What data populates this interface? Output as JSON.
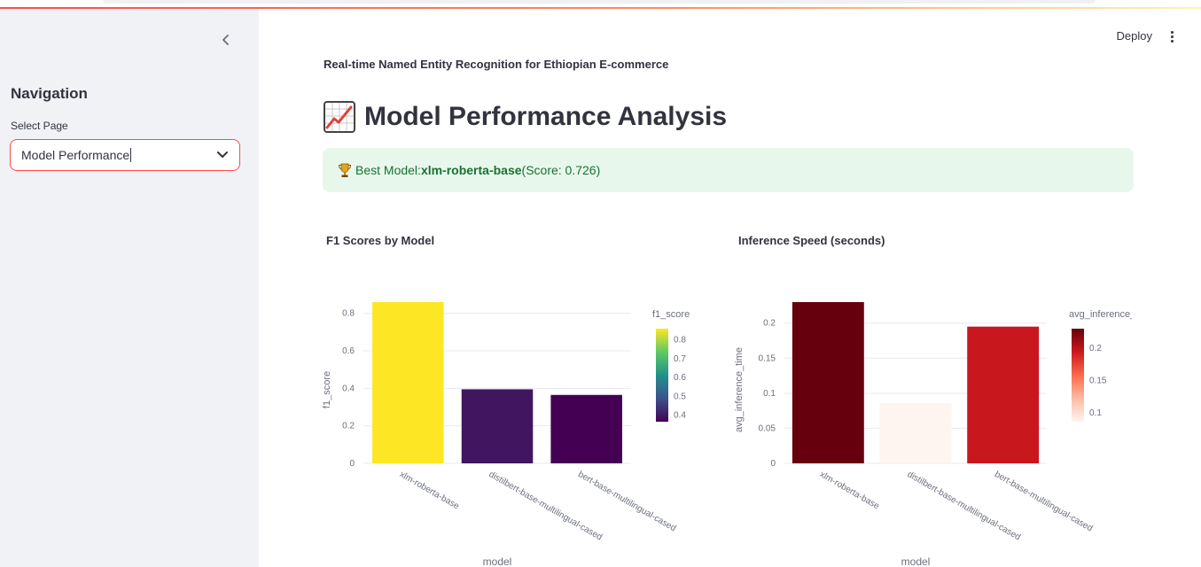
{
  "app": {
    "deploy_label": "Deploy"
  },
  "sidebar": {
    "heading": "Navigation",
    "select_label": "Select Page",
    "select_value": "Model Performance"
  },
  "main": {
    "subtitle": "Real-time Named Entity Recognition for Ethiopian E-commerce",
    "title": "Model Performance Analysis",
    "alert": {
      "prefix": "Best Model: ",
      "model": "xlm-roberta-base",
      "suffix": " (Score: 0.726)"
    }
  },
  "colors": {
    "accent": "#ff4b4b",
    "alert_bg": "#e8f7ec",
    "alert_text": "#177233"
  },
  "chart_data": [
    {
      "type": "bar",
      "title": "F1 Scores by Model",
      "xlabel": "model",
      "ylabel": "f1_score",
      "categories": [
        "xlm-roberta-base",
        "distilbert-base-multilingual-cased",
        "bert-base-multilingual-cased"
      ],
      "values": [
        0.86,
        0.395,
        0.365
      ],
      "ylim": [
        0,
        0.86
      ],
      "yticks": [
        0,
        0.2,
        0.4,
        0.6,
        0.8
      ],
      "colorscale": "Viridis",
      "color_range": [
        0.365,
        0.86
      ],
      "colorbar_title": "f1_score",
      "colorbar_ticks": [
        0.4,
        0.5,
        0.6,
        0.7,
        0.8
      ],
      "grid": true
    },
    {
      "type": "bar",
      "title": "Inference Speed (seconds)",
      "xlabel": "model",
      "ylabel": "avg_inference_time",
      "categories": [
        "xlm-roberta-base",
        "distilbert-base-multilingual-cased",
        "bert-base-multilingual-cased"
      ],
      "values": [
        0.23,
        0.086,
        0.195
      ],
      "ylim": [
        0,
        0.23
      ],
      "yticks": [
        0,
        0.05,
        0.1,
        0.15,
        0.2
      ],
      "colorscale": "Reds",
      "color_range": [
        0.086,
        0.23
      ],
      "colorbar_title": "avg_inference_time",
      "colorbar_ticks": [
        0.1,
        0.15,
        0.2
      ],
      "grid": true
    }
  ]
}
